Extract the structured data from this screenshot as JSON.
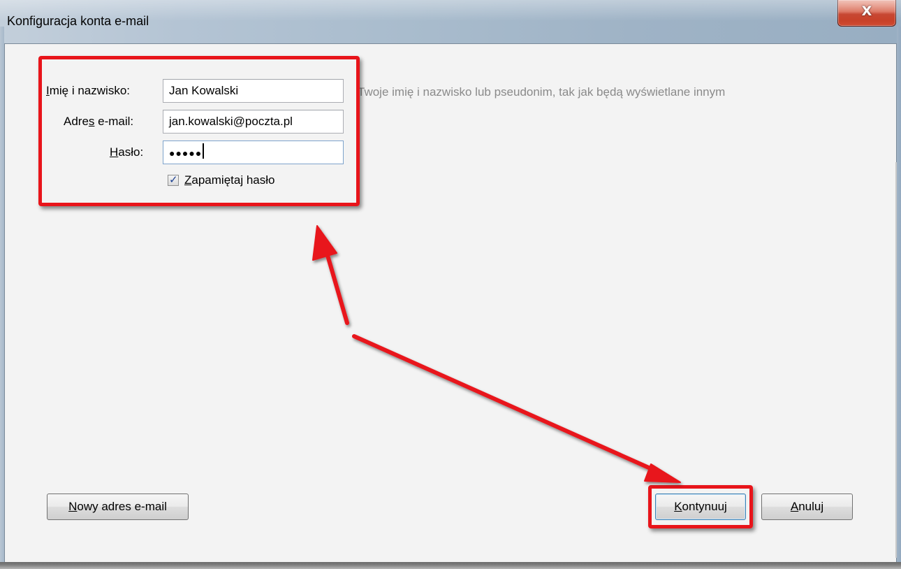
{
  "window": {
    "title": "Konfiguracja konta e-mail",
    "close_glyph": "X"
  },
  "form": {
    "name_label_first": "I",
    "name_label_rest": "mię i nazwisko:",
    "name_value": "Jan Kowalski",
    "email_label_pre": "Adre",
    "email_label_underlined": "s",
    "email_label_post": " e-mail:",
    "email_value": "jan.kowalski@poczta.pl",
    "password_label_first": "H",
    "password_label_rest": "asło:",
    "password_masked": "●●●●●",
    "name_hint": "Twoje imię i nazwisko lub pseudonim, tak jak będą wyświetlane innym",
    "remember_checked": true,
    "remember_first": "Z",
    "remember_rest": "apamiętaj hasło"
  },
  "buttons": {
    "new_email_first": "N",
    "new_email_rest": "owy adres e-mail",
    "continue_first": "K",
    "continue_rest": "ontynuuj",
    "cancel_first": "A",
    "cancel_rest": "nuluj"
  },
  "colors": {
    "annotation_red": "#e8141a",
    "dialog_bg": "#f3f3f3"
  },
  "icons": {
    "close": "close-icon",
    "check": "checkmark-icon"
  }
}
